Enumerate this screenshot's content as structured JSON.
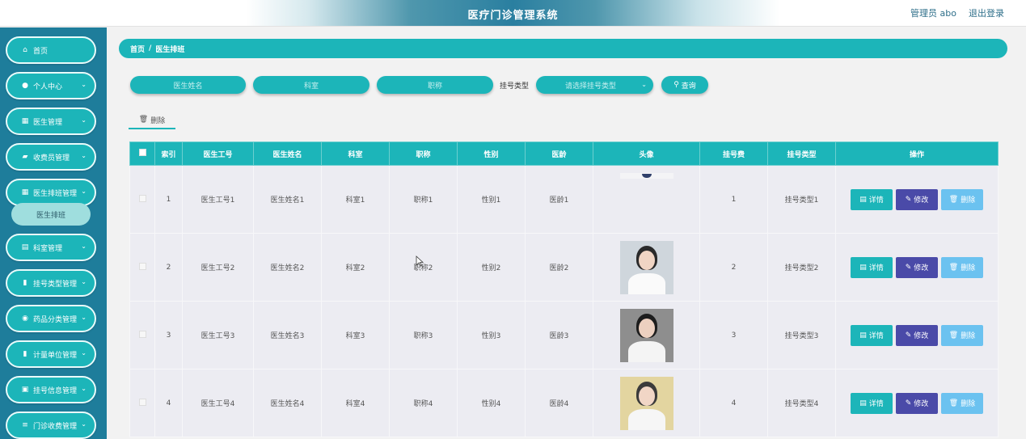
{
  "header": {
    "title": "医疗门诊管理系统",
    "user": "管理员 abo",
    "logout": "退出登录"
  },
  "sidebar": {
    "items": [
      {
        "label": "首页",
        "icon": "home-icon",
        "glyph": "⌂",
        "has_chevron": false
      },
      {
        "label": "个人中心",
        "icon": "user-icon",
        "glyph": "●",
        "has_chevron": true
      },
      {
        "label": "医生管理",
        "icon": "grid-icon",
        "glyph": "▦",
        "has_chevron": true
      },
      {
        "label": "收费员管理",
        "icon": "cash-icon",
        "glyph": "▰",
        "has_chevron": true
      },
      {
        "label": "医生排班管理",
        "icon": "grid-icon",
        "glyph": "▦",
        "has_chevron": true
      },
      {
        "label": "科室管理",
        "icon": "calendar-icon",
        "glyph": "▤",
        "has_chevron": true
      },
      {
        "label": "挂号类型管理",
        "icon": "clipboard-icon",
        "glyph": "▮",
        "has_chevron": true
      },
      {
        "label": "药品分类管理",
        "icon": "pill-icon",
        "glyph": "◉",
        "has_chevron": true
      },
      {
        "label": "计量单位管理",
        "icon": "clipboard-icon",
        "glyph": "▮",
        "has_chevron": true
      },
      {
        "label": "挂号信息管理",
        "icon": "list-icon",
        "glyph": "▣",
        "has_chevron": true
      },
      {
        "label": "门诊收费管理",
        "icon": "sliders-icon",
        "glyph": "≡",
        "has_chevron": true
      }
    ],
    "submenu": {
      "label": "医生排班"
    }
  },
  "breadcrumb": {
    "home": "首页",
    "sep": "/",
    "current": "医生排班"
  },
  "search": {
    "doctor_name_placeholder": "医生姓名",
    "department_placeholder": "科室",
    "title_placeholder": "职称",
    "reg_type_label": "挂号类型",
    "reg_type_placeholder": "请选择挂号类型",
    "query_button": "查询"
  },
  "toolbar": {
    "delete_label": "删除"
  },
  "table": {
    "headers": [
      "索引",
      "医生工号",
      "医生姓名",
      "科室",
      "职称",
      "性别",
      "医龄",
      "头像",
      "挂号费",
      "挂号类型",
      "操作"
    ],
    "rows": [
      {
        "index": "1",
        "id": "医生工号1",
        "name": "医生姓名1",
        "dept": "科室1",
        "title": "职称1",
        "gender": "性别1",
        "years": "医龄1",
        "fee": "1",
        "type": "挂号类型1"
      },
      {
        "index": "2",
        "id": "医生工号2",
        "name": "医生姓名2",
        "dept": "科室2",
        "title": "职称2",
        "gender": "性别2",
        "years": "医龄2",
        "fee": "2",
        "type": "挂号类型2"
      },
      {
        "index": "3",
        "id": "医生工号3",
        "name": "医生姓名3",
        "dept": "科室3",
        "title": "职称3",
        "gender": "性别3",
        "years": "医龄3",
        "fee": "3",
        "type": "挂号类型3"
      },
      {
        "index": "4",
        "id": "医生工号4",
        "name": "医生姓名4",
        "dept": "科室4",
        "title": "职称4",
        "gender": "性别4",
        "years": "医龄4",
        "fee": "4",
        "type": "挂号类型4"
      }
    ],
    "actions": {
      "detail": "详情",
      "edit": "修改",
      "delete": "删除"
    }
  },
  "colors": {
    "primary": "#1cb5b9",
    "sidebar_bg": "#1e7d9b",
    "edit": "#4a4aa8",
    "delete": "#6bc2f0"
  }
}
